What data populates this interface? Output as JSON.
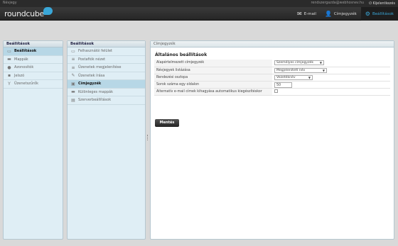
{
  "topbar": {
    "about": "Névjegy",
    "user": "rendszergazda@webhosnev.hu",
    "logout": "Kijelentkezés"
  },
  "header": {
    "logo": "roundcube"
  },
  "topnav": [
    {
      "label": "E-mail",
      "icon": "mail-icon"
    },
    {
      "label": "Címjegyzék",
      "icon": "contacts-icon"
    },
    {
      "label": "Beállítások",
      "icon": "gear-icon"
    }
  ],
  "settings_nav": {
    "title": "Beállítások",
    "items": [
      {
        "label": "Beállítások",
        "icon": "monitor-icon"
      },
      {
        "label": "Mappák",
        "icon": "folder-icon"
      },
      {
        "label": "Azonosítók",
        "icon": "identity-icon"
      },
      {
        "label": "Jelszó",
        "icon": "key-icon"
      },
      {
        "label": "Üzenetszűrők",
        "icon": "filter-icon"
      }
    ]
  },
  "sections_nav": {
    "title": "Beállítások",
    "items": [
      {
        "label": "Felhasználói felület"
      },
      {
        "label": "Postafiók nézet"
      },
      {
        "label": "Üzenetek megjelenítése"
      },
      {
        "label": "Üzenetek írása"
      },
      {
        "label": "Címjegyzék"
      },
      {
        "label": "Különleges mappák"
      },
      {
        "label": "Szerverbeállítások"
      }
    ]
  },
  "main": {
    "panel_title": "Címjegyzék",
    "box_title": "Általános beállítások",
    "rows": [
      {
        "label": "Alapértelmezett címjegyzék",
        "value": "Személyes címjegyzék"
      },
      {
        "label": "Névjegyek listázása",
        "value": "Megjelenített név"
      },
      {
        "label": "Rendezési oszlopa",
        "value": "Vezetéknév"
      },
      {
        "label": "Sorok száma egy oldalon",
        "value": "50"
      },
      {
        "label": "Alternatív e-mail címek kihagyása automatikus kiegészítéskor",
        "value": ""
      }
    ],
    "save_label": "Mentés"
  }
}
